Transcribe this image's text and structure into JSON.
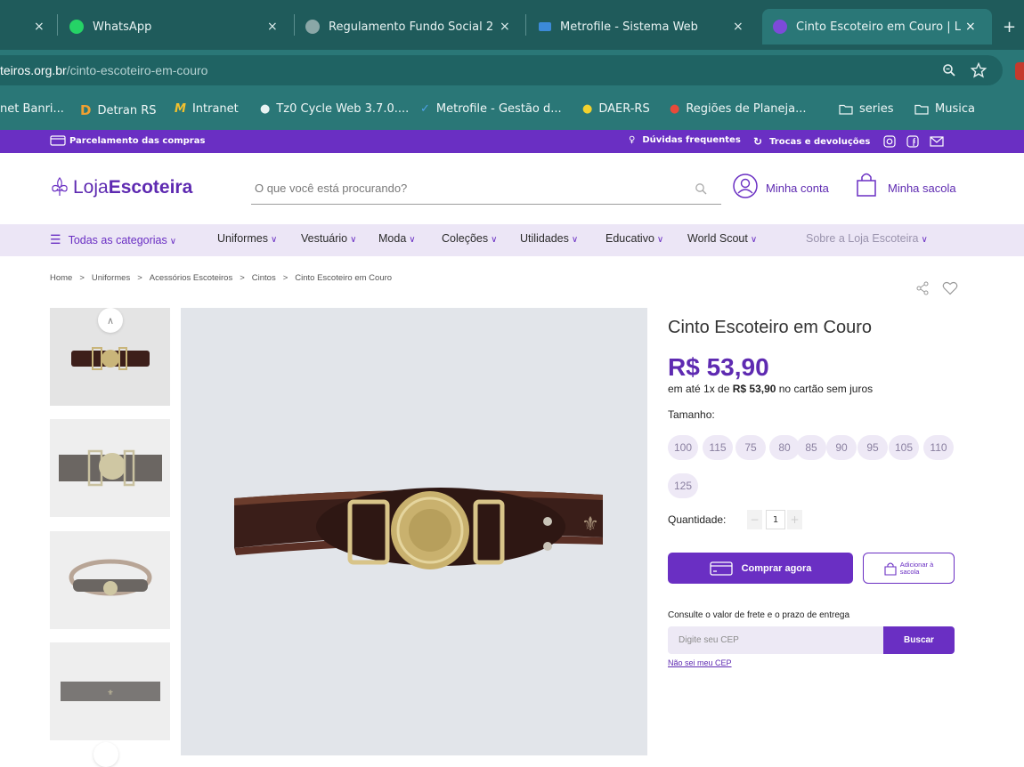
{
  "browser": {
    "tabs": [
      {
        "label": "",
        "close": "×"
      },
      {
        "label": "WhatsApp",
        "close": "×"
      },
      {
        "label": "Regulamento Fundo Social 2",
        "close": "×"
      },
      {
        "label": "Metrofile - Sistema Web",
        "close": "×"
      },
      {
        "label": "Cinto Escoteiro em Couro | L",
        "close": "×"
      }
    ],
    "new_tab": "+",
    "url_domain": "teiros.org.br",
    "url_path": "/cinto-escoteiro-em-couro",
    "bookmarks": [
      {
        "label": "net Banri...",
        "icon": ""
      },
      {
        "label": "Detran RS",
        "icon": "D"
      },
      {
        "label": "Intranet",
        "icon": "M"
      },
      {
        "label": "Tz0 Cycle Web 3.7.0....",
        "icon": "●"
      },
      {
        "label": "Metrofile - Gestão d...",
        "icon": "✓"
      },
      {
        "label": "DAER-RS",
        "icon": "●"
      },
      {
        "label": "Regiões de Planeja...",
        "icon": "●"
      },
      {
        "label": "series",
        "icon": "folder"
      },
      {
        "label": "Musica",
        "icon": "folder"
      }
    ]
  },
  "topbar": {
    "installments": "Parcelamento das compras",
    "faq": "Dúvidas frequentes",
    "returns": "Trocas e devoluções"
  },
  "header": {
    "logo_light": "Loja",
    "logo_bold": "Escoteira",
    "search_placeholder": "O que você está procurando?",
    "account": "Minha conta",
    "bag": "Minha sacola"
  },
  "nav": {
    "all": "Todas as categorias",
    "items": [
      "Uniformes",
      "Vestuário",
      "Moda",
      "Coleções",
      "Utilidades",
      "Educativo",
      "World Scout"
    ],
    "about": "Sobre a Loja Escoteira"
  },
  "breadcrumb": [
    "Home",
    "Uniformes",
    "Acessórios Escoteiros",
    "Cintos",
    "Cinto Escoteiro em Couro"
  ],
  "product": {
    "title": "Cinto Escoteiro em Couro",
    "price": "R$ 53,90",
    "installment_prefix": "em até 1x de ",
    "installment_value": "R$ 53,90",
    "installment_suffix": " no cartão sem juros",
    "size_label": "Tamanho:",
    "sizes": [
      "100",
      "115",
      "75",
      "80",
      "85",
      "90",
      "95",
      "105",
      "110",
      "125"
    ],
    "qty_label": "Quantidade:",
    "qty": "1",
    "qty_minus": "−",
    "qty_plus": "+",
    "buy": "Comprar agora",
    "add_bag_1": "Adicionar à",
    "add_bag_2": "sacola",
    "freight": "Consulte o valor de frete e o prazo de entrega",
    "cep_placeholder": "Digite seu CEP",
    "cep_button": "Buscar",
    "no_cep": "Não sei meu CEP"
  },
  "colors": {
    "brand": "#6a2fc3",
    "chrome": "#2a7777"
  }
}
